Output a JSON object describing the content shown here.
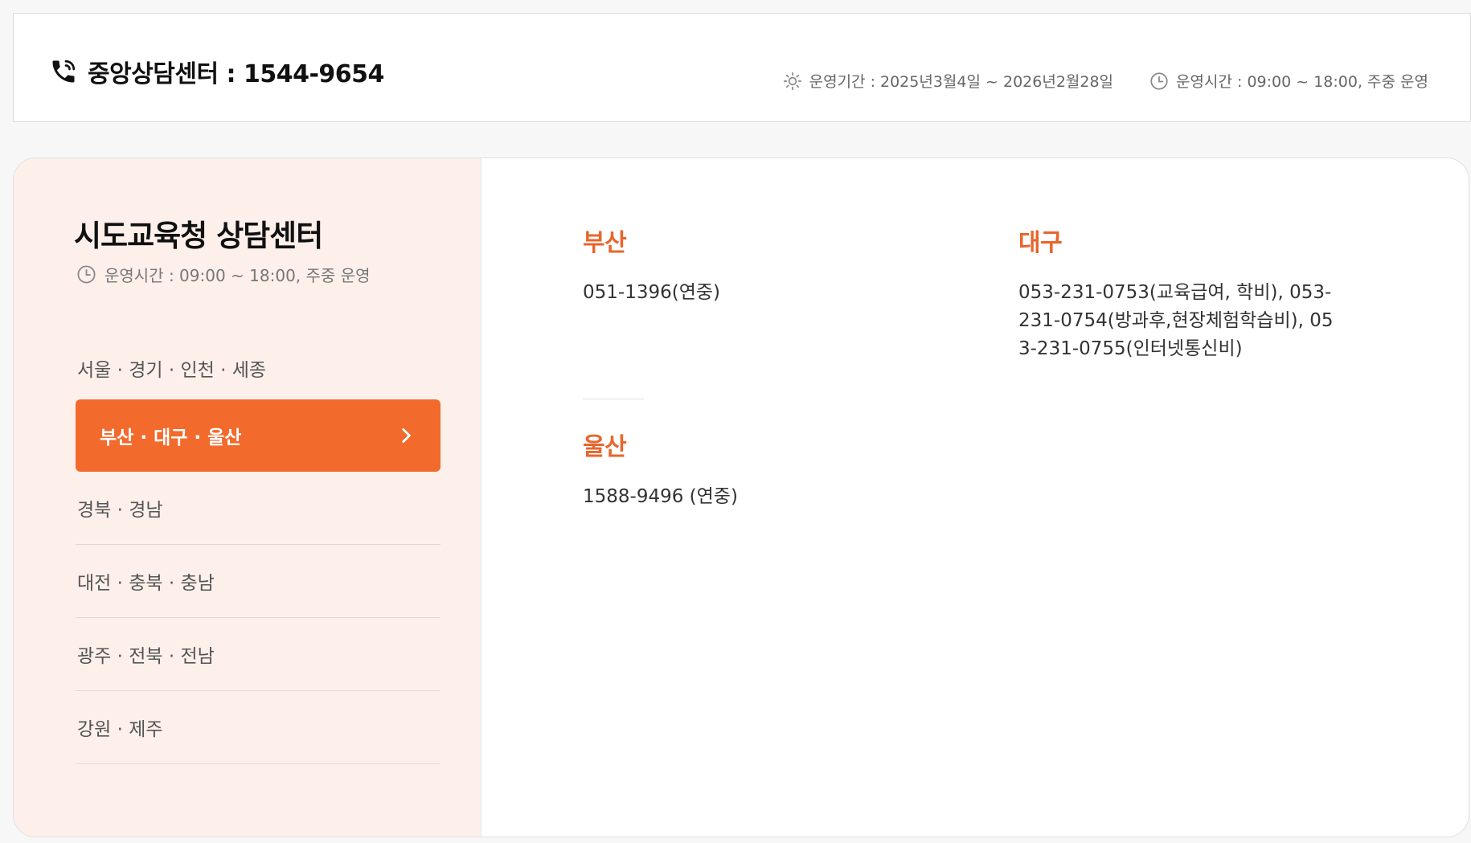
{
  "header": {
    "central_center_label": "중앙상담센터 : 1544-9654",
    "period_label": "운영기간 : 2025년3월4일 ~ 2026년2월28일",
    "hours_label": "운영시간 : 09:00 ~ 18:00, 주중 운영"
  },
  "sidebar": {
    "title": "시도교육청 상담센터",
    "hours": "운영시간 : 09:00 ~ 18:00, 주중 운영",
    "regions": [
      "서울 · 경기 · 인천 · 세종",
      "부산 · 대구 · 울산",
      "경북 · 경남",
      "대전 · 충북 · 충남",
      "광주 · 전북 · 전남",
      "강원 · 제주"
    ],
    "active_index": 1
  },
  "centers": {
    "busan": {
      "city": "부산",
      "tel": "051-1396(연중)"
    },
    "daegu": {
      "city": "대구",
      "tel": "053-231-0753(교육급여, 학비), 053-231-0754(방과후,현장체험학습비), 053-231-0755(인터넷통신비)"
    },
    "ulsan": {
      "city": "울산",
      "tel": "1588-9496 (연중)"
    }
  },
  "colors": {
    "accent": "#f26a2c",
    "accent_text": "#e8652d",
    "sidebar_bg": "#fdf0ea"
  },
  "icons": {
    "phone": "phone-icon",
    "period": "sun-icon",
    "hours": "clock-icon",
    "chevron": "chevron-right-icon"
  }
}
